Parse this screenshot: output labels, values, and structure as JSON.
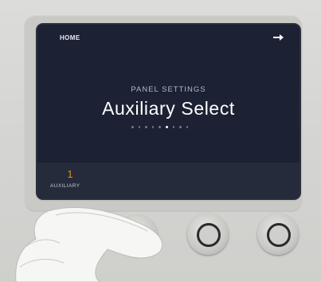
{
  "screen": {
    "breadcrumb": "HOME",
    "next_icon": "arrow-right-icon",
    "subtitle": "PANEL SETTINGS",
    "title": "Auxiliary Select",
    "page_dots": {
      "count": 9,
      "active_index": 5
    },
    "accent_color": "#e28a1c"
  },
  "soft_button": {
    "value": "1",
    "label": "AUXILIARY"
  },
  "knobs": [
    "knob",
    "knob",
    "knob",
    "knob"
  ]
}
